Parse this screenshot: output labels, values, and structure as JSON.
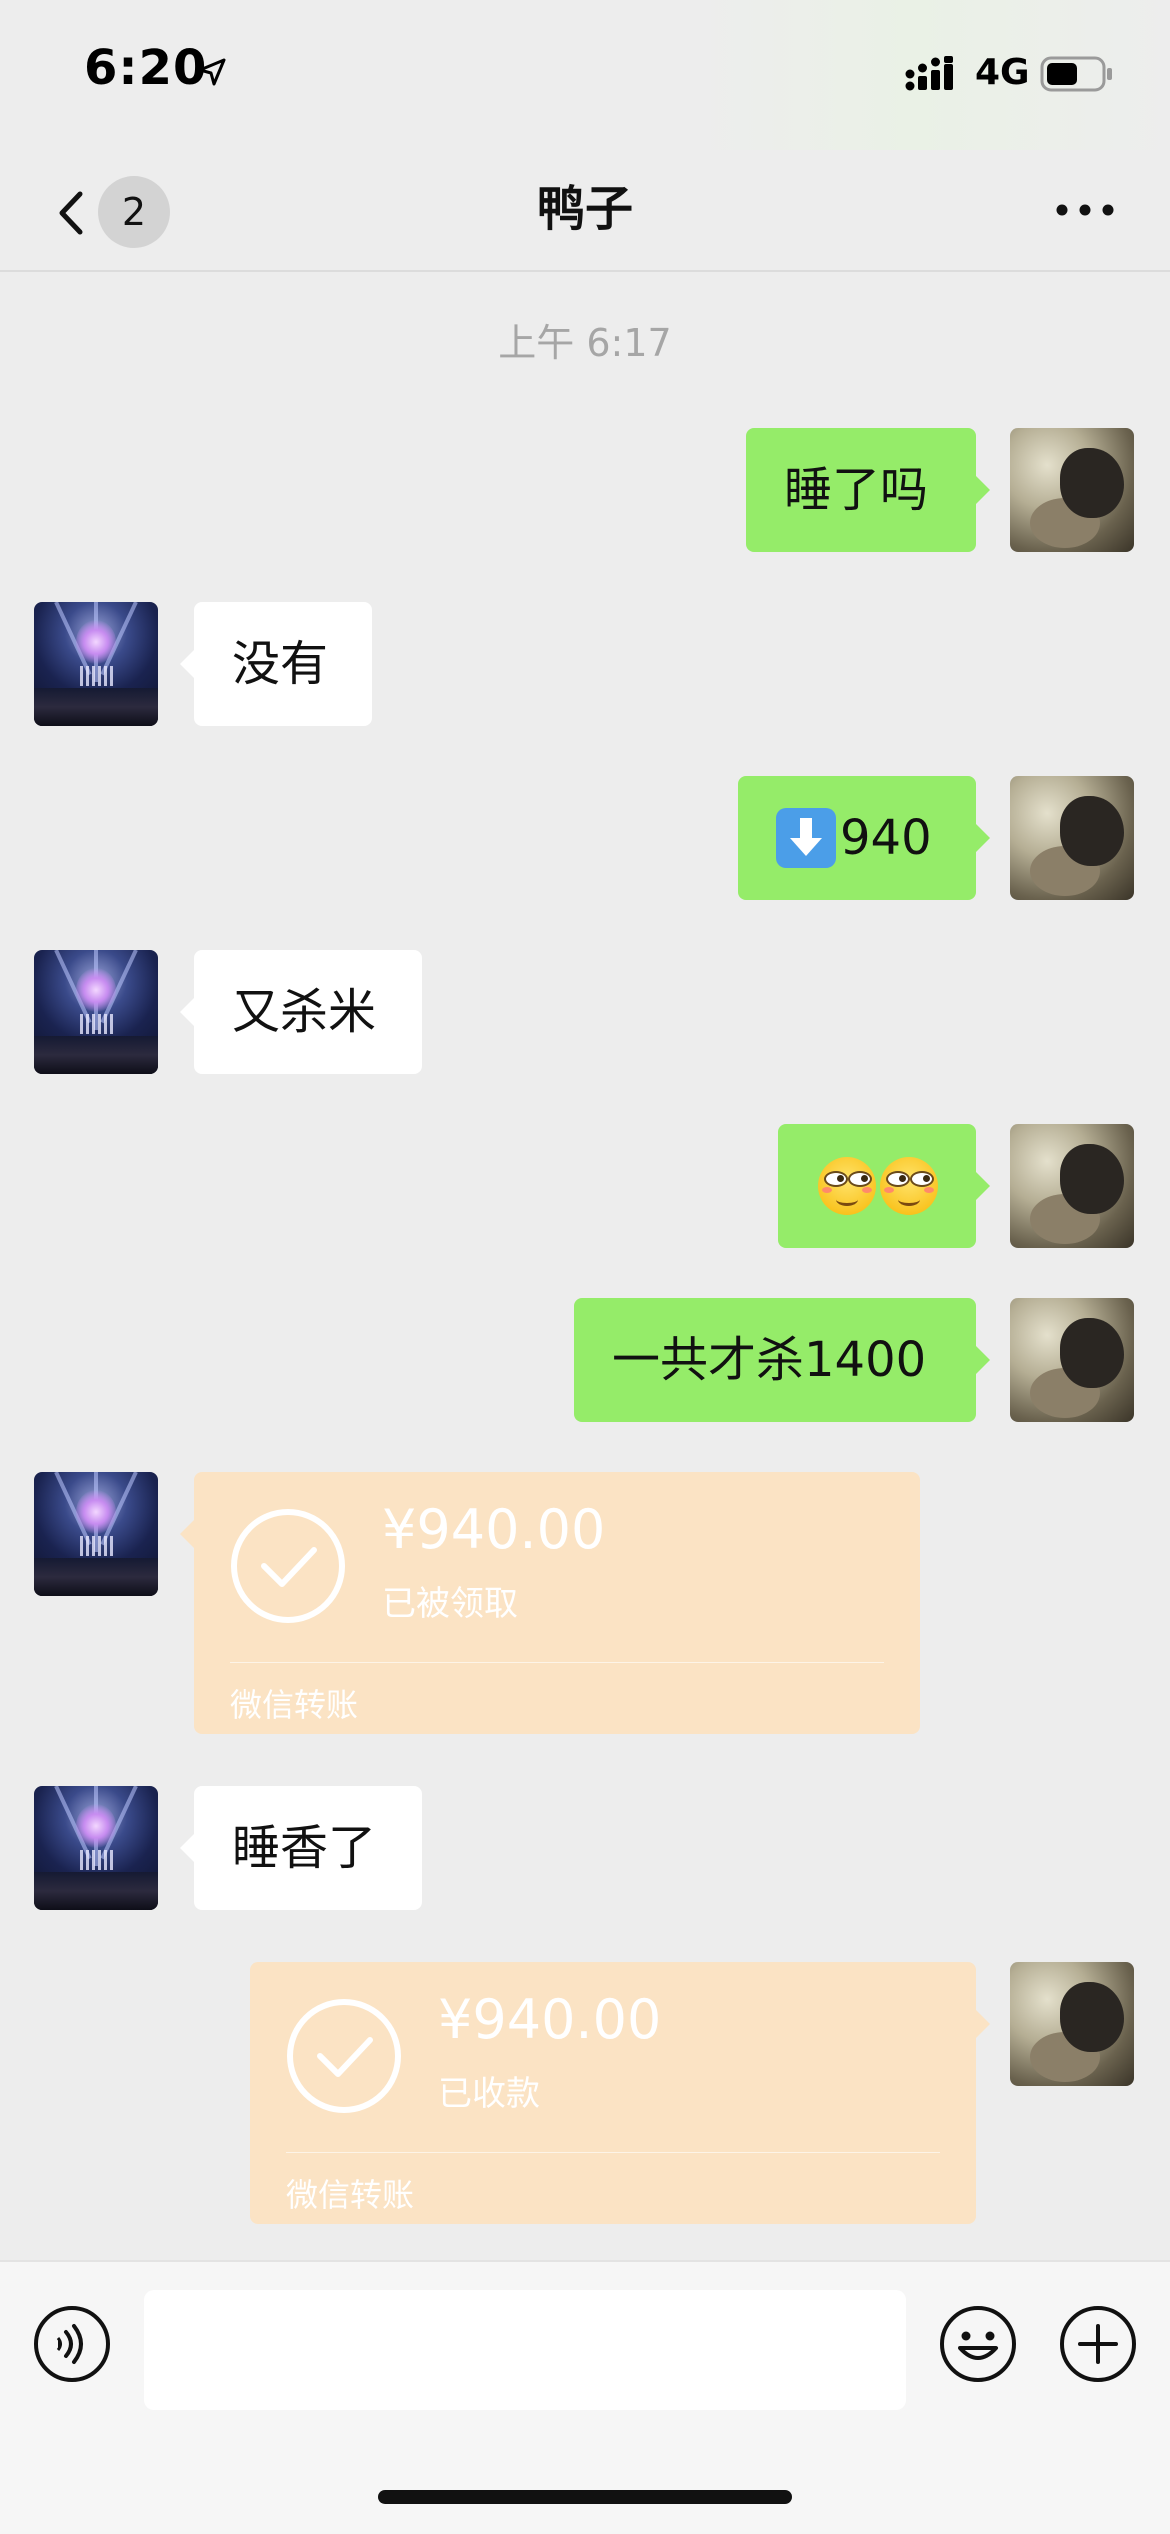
{
  "status_bar": {
    "time": "6:20",
    "network": "4G"
  },
  "nav": {
    "unread_count": "2",
    "title": "鸭子"
  },
  "chat": {
    "timestamp": "上午 6:17",
    "messages": [
      {
        "side": "outgoing",
        "text": "睡了吗"
      },
      {
        "side": "incoming",
        "text": "没有"
      },
      {
        "side": "outgoing",
        "emoji": "down-arrow-emoji",
        "text": "940"
      },
      {
        "side": "incoming",
        "text": "又杀米"
      },
      {
        "side": "outgoing",
        "emoji": "smirk-face-emoji x2",
        "text": ""
      },
      {
        "side": "outgoing",
        "text": "一共才杀1400"
      },
      {
        "side": "incoming",
        "type": "transfer",
        "amount": "¥940.00",
        "status": "已被领取",
        "label": "微信转账"
      },
      {
        "side": "incoming",
        "text": "睡香了"
      },
      {
        "side": "outgoing",
        "type": "transfer",
        "amount": "¥940.00",
        "status": "已收款",
        "label": "微信转账"
      }
    ]
  },
  "input_bar": {
    "placeholder": "",
    "value": ""
  },
  "colors": {
    "background": "#ededed",
    "outgoing_bubble": "#95ec69",
    "incoming_bubble": "#ffffff",
    "transfer_card": "#fbe3c4",
    "timestamp": "#a6a6a6"
  }
}
